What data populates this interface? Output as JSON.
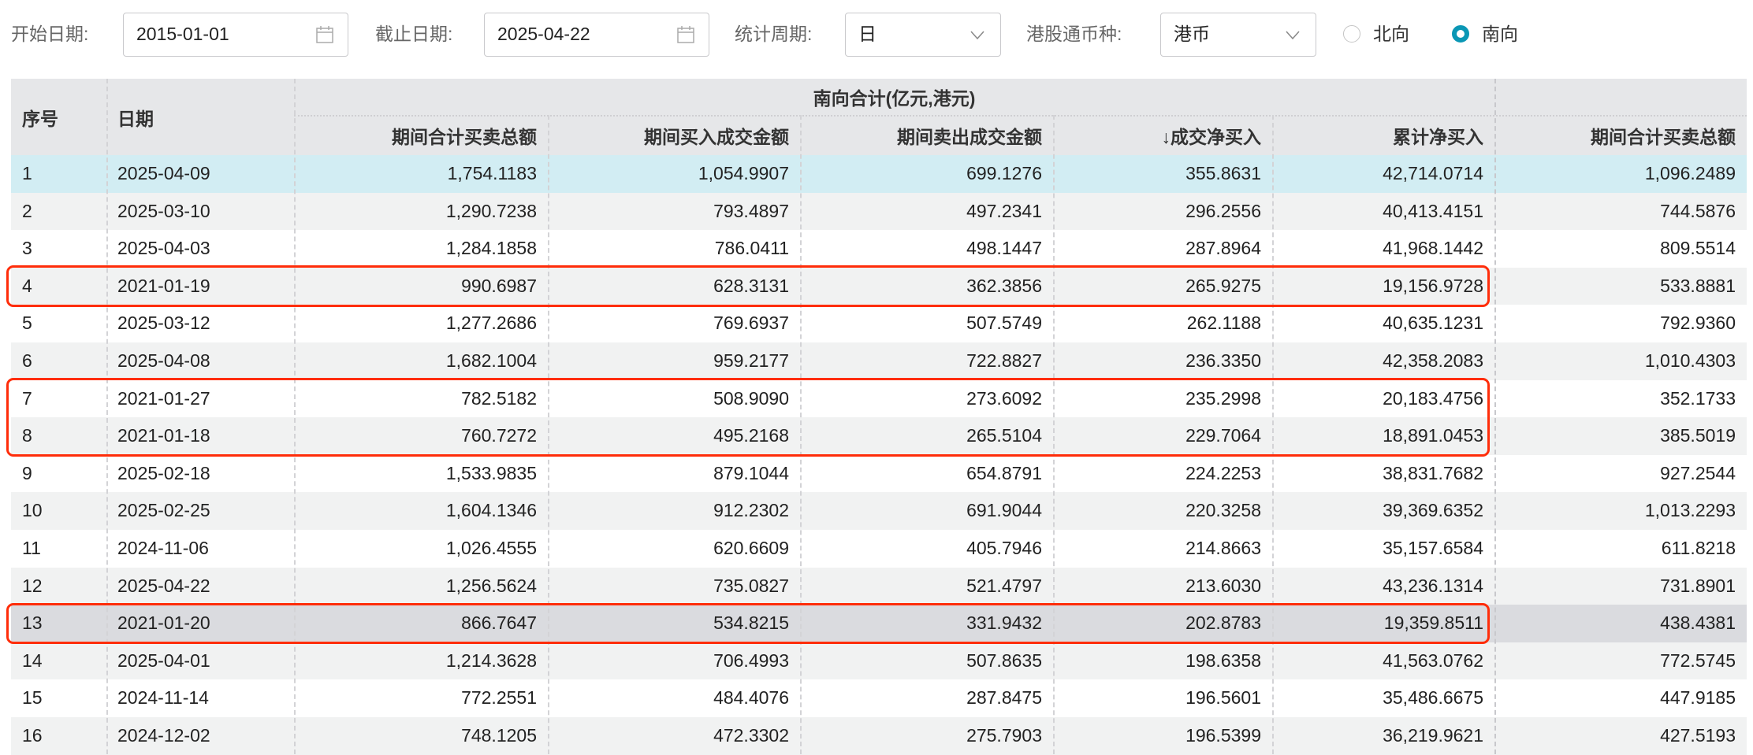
{
  "filters": {
    "start_label": "开始日期:",
    "start_value": "2015-01-01",
    "end_label": "截止日期:",
    "end_value": "2025-04-22",
    "period_label": "统计周期:",
    "period_value": "日",
    "currency_label": "港股通币种:",
    "currency_value": "港币",
    "radio_north": "北向",
    "radio_south": "南向",
    "selected_direction": "南向"
  },
  "table": {
    "group_header": "南向合计(亿元,港元)",
    "headers": [
      "序号",
      "日期",
      "期间合计买卖总额",
      "期间买入成交金额",
      "期间卖出成交金额",
      "↓成交净买入",
      "累计净买入",
      "期间合计买卖总额"
    ],
    "rows": [
      [
        "1",
        "2025-04-09",
        "1,754.1183",
        "1,054.9907",
        "699.1276",
        "355.8631",
        "42,714.0714",
        "1,096.2489"
      ],
      [
        "2",
        "2025-03-10",
        "1,290.7238",
        "793.4897",
        "497.2341",
        "296.2556",
        "40,413.4151",
        "744.5876"
      ],
      [
        "3",
        "2025-04-03",
        "1,284.1858",
        "786.0411",
        "498.1447",
        "287.8964",
        "41,968.1442",
        "809.5514"
      ],
      [
        "4",
        "2021-01-19",
        "990.6987",
        "628.3131",
        "362.3856",
        "265.9275",
        "19,156.9728",
        "533.8881"
      ],
      [
        "5",
        "2025-03-12",
        "1,277.2686",
        "769.6937",
        "507.5749",
        "262.1188",
        "40,635.1231",
        "792.9360"
      ],
      [
        "6",
        "2025-04-08",
        "1,682.1004",
        "959.2177",
        "722.8827",
        "236.3350",
        "42,358.2083",
        "1,010.4303"
      ],
      [
        "7",
        "2021-01-27",
        "782.5182",
        "508.9090",
        "273.6092",
        "235.2998",
        "20,183.4756",
        "352.1733"
      ],
      [
        "8",
        "2021-01-18",
        "760.7272",
        "495.2168",
        "265.5104",
        "229.7064",
        "18,891.0453",
        "385.5019"
      ],
      [
        "9",
        "2025-02-18",
        "1,533.9835",
        "879.1044",
        "654.8791",
        "224.2253",
        "38,831.7682",
        "927.2544"
      ],
      [
        "10",
        "2025-02-25",
        "1,604.1346",
        "912.2302",
        "691.9044",
        "220.3258",
        "39,369.6352",
        "1,013.2293"
      ],
      [
        "11",
        "2024-11-06",
        "1,026.4555",
        "620.6609",
        "405.7946",
        "214.8663",
        "35,157.6584",
        "611.8218"
      ],
      [
        "12",
        "2025-04-22",
        "1,256.5624",
        "735.0827",
        "521.4797",
        "213.6030",
        "43,236.1314",
        "731.8901"
      ],
      [
        "13",
        "2021-01-20",
        "866.7647",
        "534.8215",
        "331.9432",
        "202.8783",
        "19,359.8511",
        "438.4381"
      ],
      [
        "14",
        "2025-04-01",
        "1,214.3628",
        "706.4993",
        "507.8635",
        "198.6358",
        "41,563.0762",
        "772.5745"
      ],
      [
        "15",
        "2024-11-14",
        "772.2551",
        "484.4076",
        "287.8475",
        "196.5601",
        "35,486.6675",
        "447.9185"
      ],
      [
        "16",
        "2024-12-02",
        "748.1205",
        "472.3302",
        "275.7903",
        "196.5399",
        "36,219.9621",
        "427.5193"
      ]
    ],
    "selected_row": 1,
    "hovered_row": 13,
    "highlighted_rows": [
      [
        4
      ],
      [
        7,
        8
      ],
      [
        13
      ]
    ]
  },
  "colors": {
    "accent": "#0a97b5",
    "highlight": "#ff2d0a",
    "selected_bg": "#d2edf3",
    "hover_bg": "#dadbdf",
    "stripe_bg": "#f1f2f2"
  }
}
